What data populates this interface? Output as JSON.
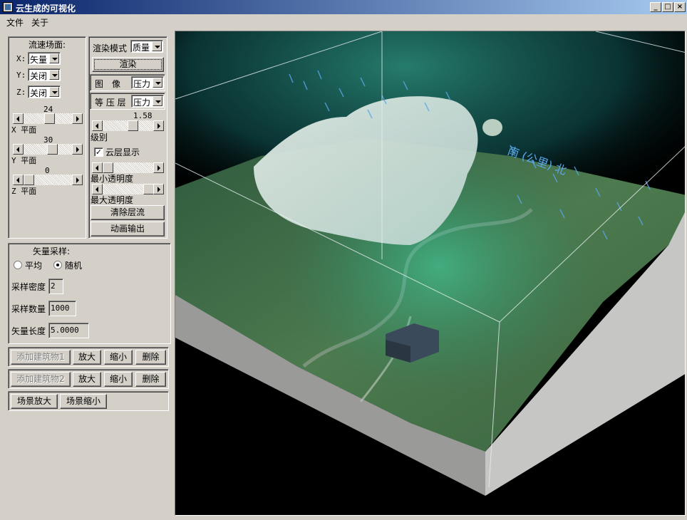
{
  "window": {
    "title": "云生成的可视化",
    "min_label": "_",
    "max_label": "□",
    "close_label": "×"
  },
  "menu": [
    "文件",
    "关于"
  ],
  "flow_field": {
    "heading": "流速场面:",
    "x_label": "X:",
    "x_value": "矢量",
    "y_label": "Y:",
    "y_value": "关闭",
    "z_label": "Z:",
    "z_value": "关闭",
    "x_plane_value": "24",
    "x_plane_label": "X 平面",
    "y_plane_value": "30",
    "y_plane_label": "Y 平面",
    "z_plane_value": "0",
    "z_plane_label": "Z 平面"
  },
  "render": {
    "mode_label": "渲染模式",
    "mode_value": "质量",
    "render_button": "渲染",
    "image_label": "图　像",
    "image_value": "压力",
    "iso_label": "等 压 层",
    "iso_value": "压力",
    "level_value": "1.58",
    "level_label": "级别",
    "cloud_checkbox": "云层显示",
    "cloud_checked": true,
    "min_transparency_label": "最小透明度",
    "max_transparency_label": "最大透明度",
    "clear_button": "清除层流",
    "animate_button": "动画输出"
  },
  "sampling": {
    "heading": "矢量采样:",
    "radio_average": "平均",
    "radio_random": "随机",
    "selected": "随机",
    "density_label": "采样密度",
    "density_value": "2",
    "count_label": "采样数量",
    "count_value": "1000",
    "length_label": "矢量长度",
    "length_value": "5.0000"
  },
  "building1": {
    "add": "添加建筑物1",
    "zoom_in": "放大",
    "zoom_out": "缩小",
    "delete": "删除"
  },
  "building2": {
    "add": "添加建筑物2",
    "zoom_in": "放大",
    "zoom_out": "缩小",
    "delete": "删除"
  },
  "scene": {
    "zoom_in": "场景放大",
    "zoom_out": "场景缩小"
  },
  "viewport": {
    "axis_text": "南 (公里) 北",
    "colors": {
      "background": "#000000",
      "terrain": "#3f6a43",
      "cloud": "#dde8e6",
      "fog": "#22a88a",
      "building": "#3a4a5a"
    }
  }
}
